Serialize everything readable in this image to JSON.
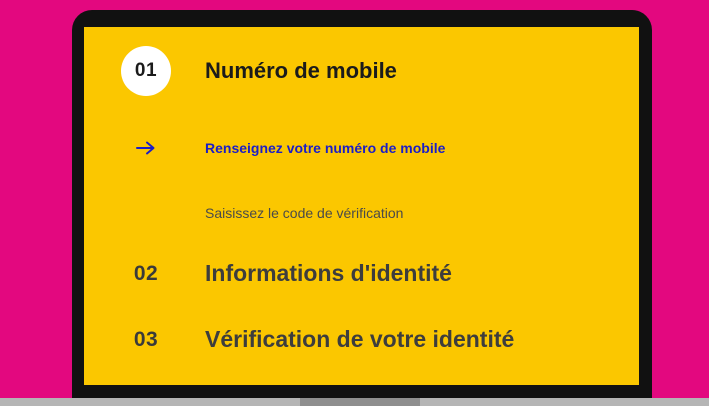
{
  "colors": {
    "background": "#e3087f",
    "panel": "#fbc700",
    "frame": "#111111",
    "active_link": "#1b1ec8",
    "badge": "#ffffff"
  },
  "steps": [
    {
      "number": "01",
      "title": "Numéro de mobile",
      "state": "active",
      "substeps": [
        {
          "label": "Renseignez votre numéro de mobile",
          "state": "current",
          "icon": "arrow-right-icon"
        },
        {
          "label": "Saisissez le code de vérification",
          "state": "pending"
        }
      ]
    },
    {
      "number": "02",
      "title": "Informations d'identité",
      "state": "pending"
    },
    {
      "number": "03",
      "title": "Vérification de votre identité",
      "state": "pending"
    }
  ]
}
